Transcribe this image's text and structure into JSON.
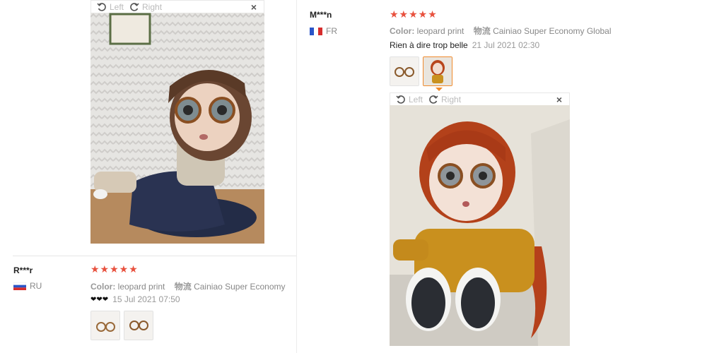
{
  "viewer": {
    "left_label": "Left",
    "right_label": "Right",
    "close_label": "×"
  },
  "reviews": [
    {
      "user": "M***n",
      "country": "FR",
      "stars": "★★★★★",
      "color_label": "Color:",
      "color_value": "leopard print",
      "shipping_label": "物流",
      "shipping_value": "Cainiao Super Economy Global",
      "feedback": "Rien à dire trop belle",
      "date": "21 Jul 2021 02:30"
    },
    {
      "user": "R***r",
      "country": "RU",
      "stars": "★★★★★",
      "color_label": "Color:",
      "color_value": "leopard print",
      "shipping_label": "物流",
      "shipping_value": "Cainiao Super Economy",
      "feedback": "❤❤❤",
      "date": "15 Jul 2021 07:50"
    }
  ],
  "colors": {
    "star": "#e8513e",
    "active_thumb": "#f08a2c"
  }
}
